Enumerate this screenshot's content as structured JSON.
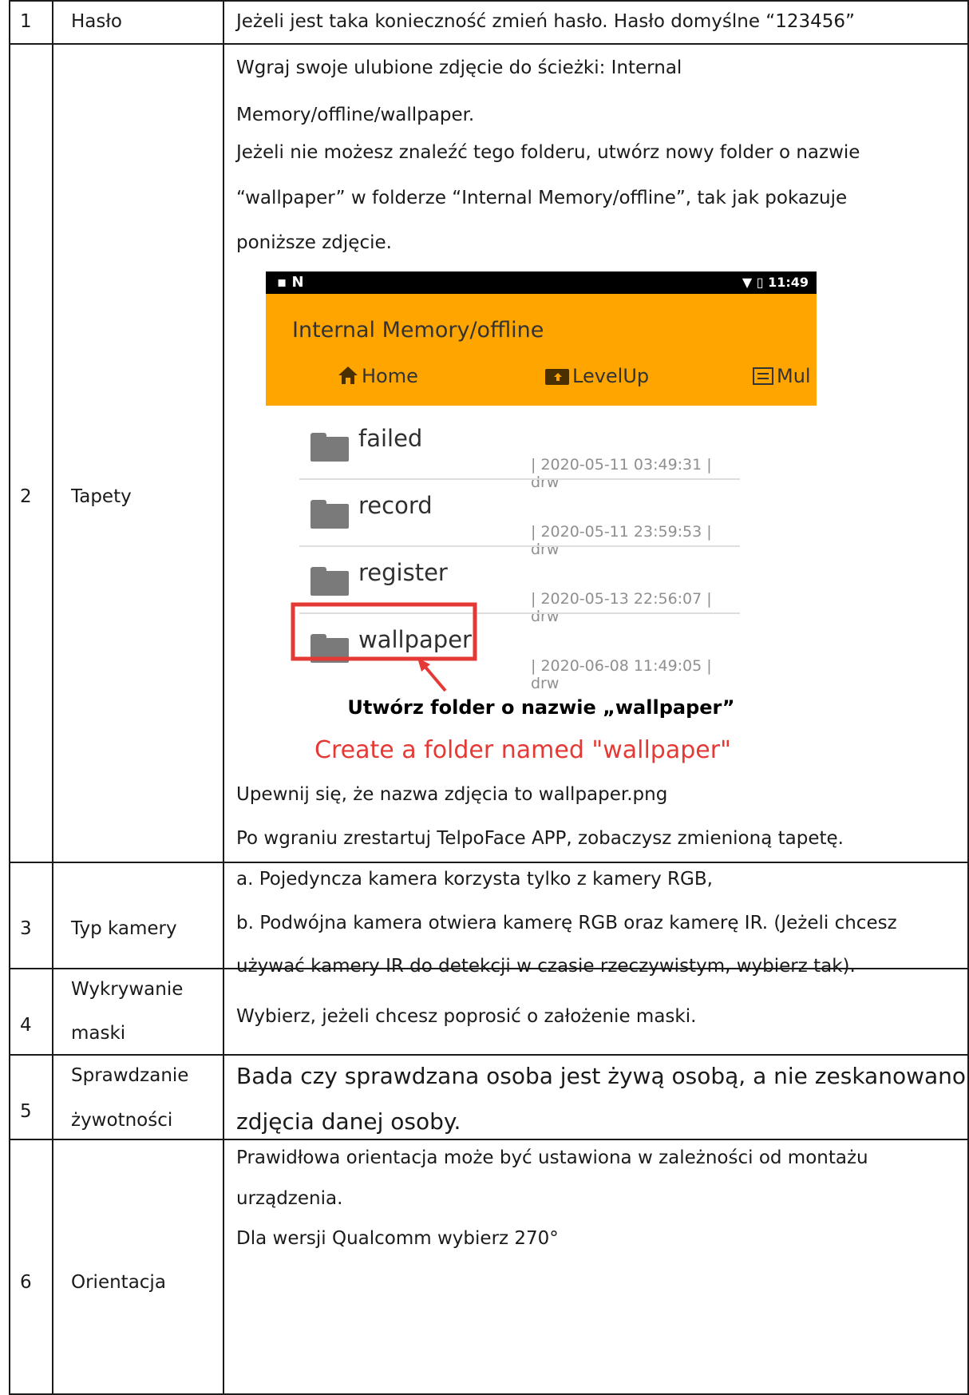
{
  "rows": [
    {
      "num": "1",
      "label": "Hasło",
      "desc": "Jeżeli jest taka konieczność zmień hasło. Hasło domyślne “123456”"
    },
    {
      "num": "2",
      "label": "Tapety",
      "desc": [
        "Wgraj swoje ulubione zdjęcie do ścieżki: Internal",
        "Memory/offline/wallpaper.",
        "Jeżeli nie możesz znaleźć tego folderu, utwórz nowy folder o nazwie",
        "“wallpaper” w folderze “Internal Memory/offline”, tak jak pokazuje",
        "poniższe zdjęcie."
      ],
      "after": [
        "Upewnij się, że nazwa zdjęcia to wallpaper.png",
        "Po wgraniu zrestartuj TelpoFace APP, zobaczysz zmienioną tapetę."
      ]
    },
    {
      "num": "3",
      "label": "Typ kamery",
      "desc": [
        "a. Pojedyncza kamera korzysta tylko z kamery RGB,",
        "b. Podwójna kamera otwiera kamerę RGB oraz kamerę IR. (Jeżeli chcesz",
        "używać kamery IR do detekcji w czasie rzeczywistym, wybierz tak)."
      ]
    },
    {
      "num": "4",
      "label": [
        "Wykrywanie",
        "maski"
      ],
      "desc": "Wybierz, jeżeli chcesz poprosić o założenie maski."
    },
    {
      "num": "5",
      "label": [
        "Sprawdzanie",
        "żywotności"
      ],
      "desc": [
        "Bada czy sprawdzana osoba jest żywą osobą, a nie zeskanowano",
        "zdjęcia danej osoby."
      ]
    },
    {
      "num": "6",
      "label": "Orientacja",
      "desc": [
        "Prawidłowa orientacja może być ustawiona w zależności od montażu",
        "urządzenia.",
        "Dla wersji Qualcomm wybierz 270°"
      ]
    }
  ],
  "screenshot": {
    "status_left": "▪ N",
    "status_right": "▼ ▯ 11:49",
    "path": "Internal Memory/offline",
    "nav": {
      "home": "Home",
      "levelup": "LevelUp",
      "multi": "Mul"
    },
    "folders": [
      {
        "name": "failed",
        "meta": "| 2020-05-11 03:49:31 | drw"
      },
      {
        "name": "record",
        "meta": "| 2020-05-11 23:59:53 | drw"
      },
      {
        "name": "register",
        "meta": "| 2020-05-13 22:56:07 | drw"
      },
      {
        "name": "wallpaper",
        "meta": "| 2020-06-08 11:49:05 | drw"
      }
    ],
    "caption_pl": "Utwórz folder o nazwie „wallpaper”",
    "caption_en": "Create a folder named \"wallpaper\"",
    "colors": {
      "appbar": "#ffa500",
      "highlight": "#e53935",
      "caption_en": "#e53935"
    },
    "icons": [
      "home-icon",
      "folder-up-icon",
      "list-icon",
      "folder-icon",
      "wifi-icon",
      "battery-icon"
    ]
  }
}
